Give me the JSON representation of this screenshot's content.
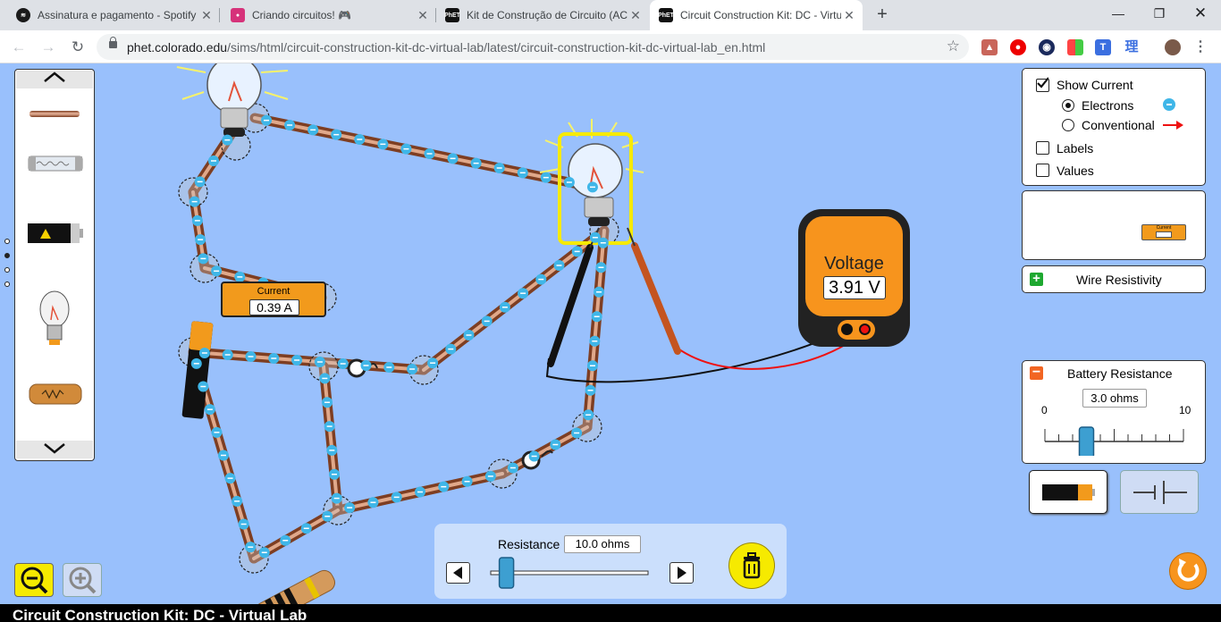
{
  "browser": {
    "tabs": [
      {
        "title": "Assinatura e pagamento - Spotify",
        "favicon": "spotify-icon",
        "active": false
      },
      {
        "title": "Criando circuitos! 🎮",
        "favicon": "classroom-icon",
        "active": false
      },
      {
        "title": "Kit de Construção de Circuito (AC)",
        "favicon": "phet-icon",
        "active": false
      },
      {
        "title": "Circuit Construction Kit: DC - Virtual Lab",
        "favicon": "phet-icon",
        "active": true
      }
    ],
    "url_host": "phet.colorado.edu",
    "url_path": "/sims/html/circuit-construction-kit-dc-virtual-lab/latest/circuit-construction-kit-dc-virtual-lab_en.html",
    "ext_icon_reading": "理"
  },
  "sim": {
    "title": "Circuit Construction Kit: DC - Virtual Lab",
    "ammeter": {
      "label": "Current",
      "value": "0.39 A"
    },
    "voltmeter": {
      "label": "Voltage",
      "value": "3.91 V"
    },
    "toolbox_ammeter_label": "Current",
    "controls": {
      "show_current": "Show Current",
      "electrons": "Electrons",
      "conventional": "Conventional",
      "labels": "Labels",
      "values": "Values",
      "show_current_checked": true,
      "electrons_selected": true,
      "labels_checked": false,
      "values_checked": false
    },
    "wire_resistivity": "Wire Resistivity",
    "battery_resistance": {
      "title": "Battery Resistance",
      "value": "3.0 ohms",
      "min": "0",
      "max": "10",
      "level": 3.0
    },
    "resistance_edit": {
      "label": "Resistance",
      "value": "10.0 ohms",
      "level": 10.0,
      "max": 100
    },
    "colors": {
      "background": "#99c0fc",
      "electron": "#3fb6e8",
      "wire": "#b5704e",
      "highlight": "#ffff00",
      "voltmeter": "#f7941d"
    }
  }
}
